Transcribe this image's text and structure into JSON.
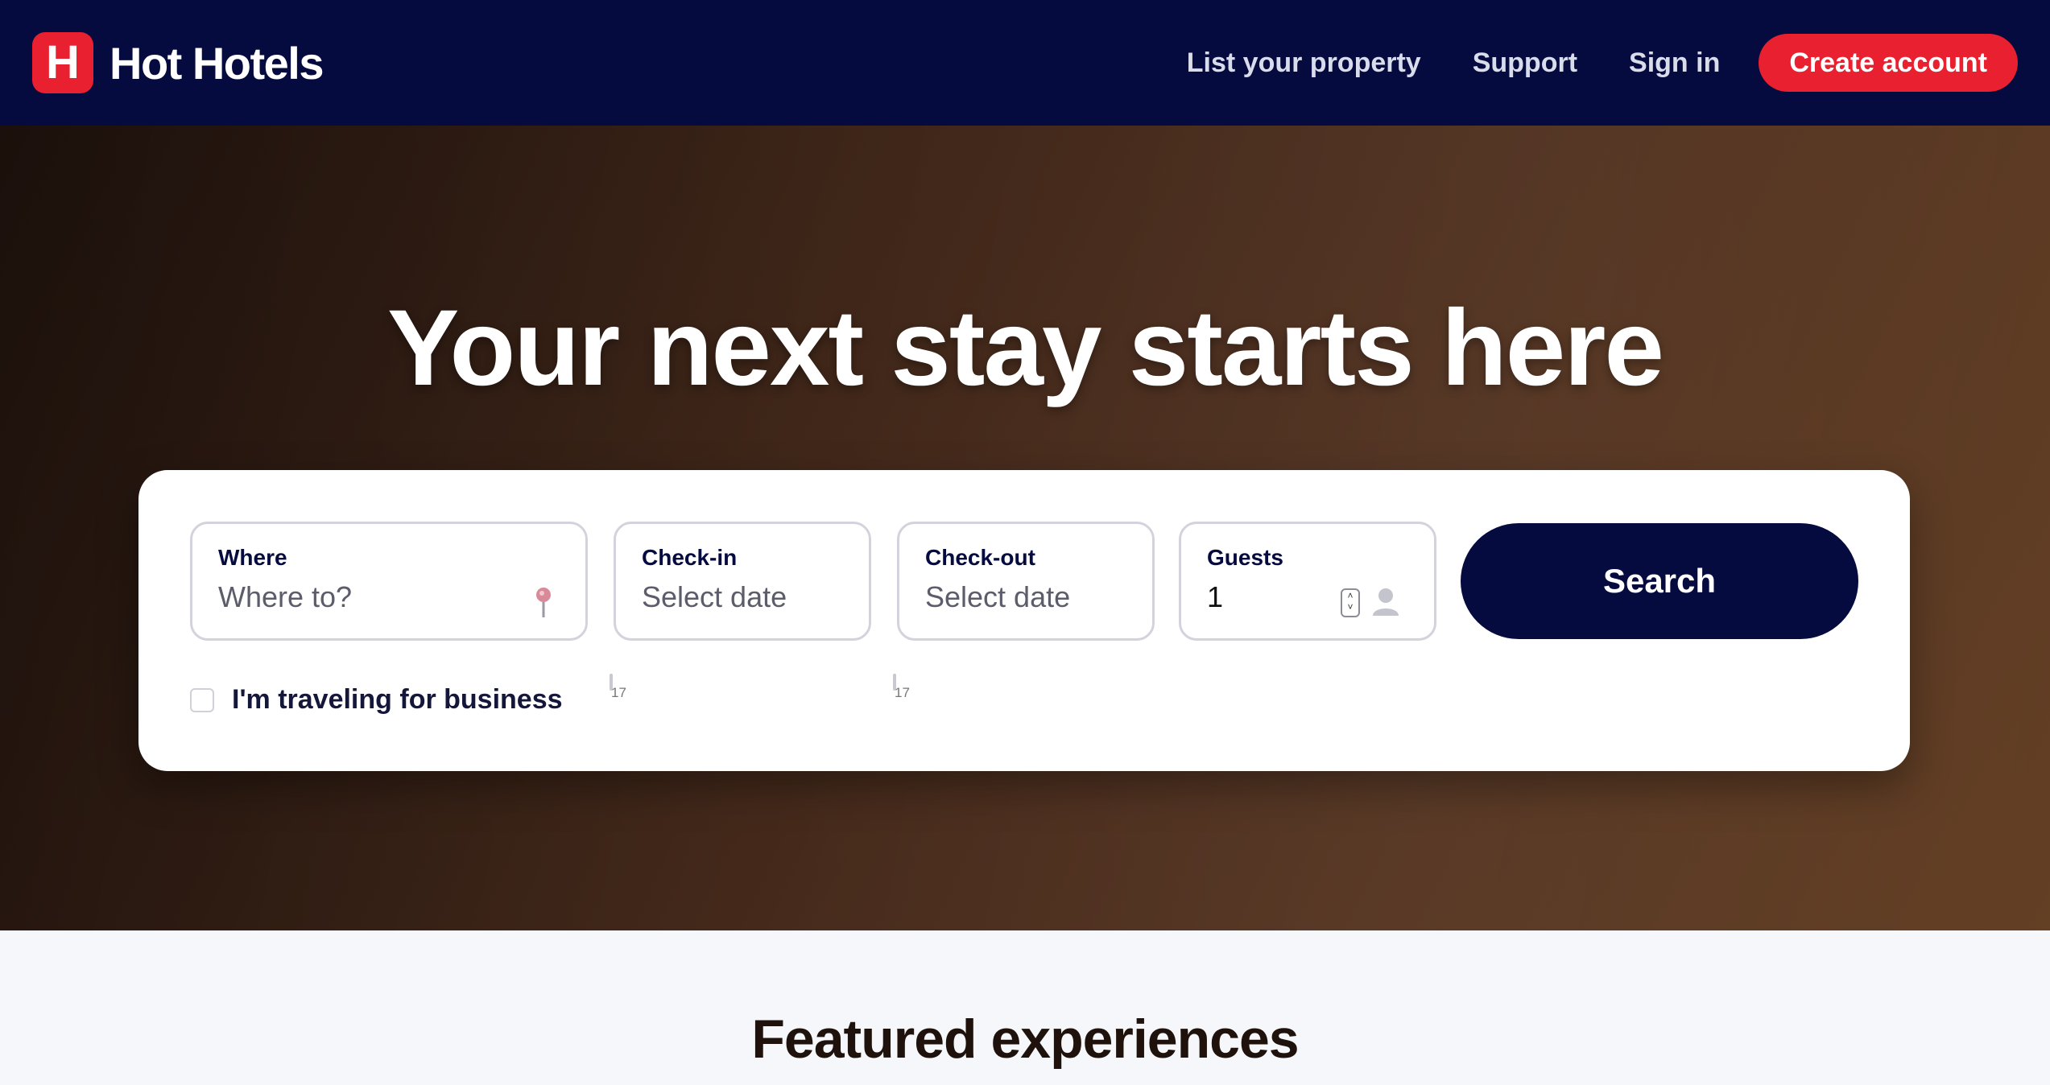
{
  "nav": {
    "brand_letter": "H",
    "brand_name": "Hot Hotels",
    "links": [
      "List your property",
      "Support",
      "Sign in"
    ],
    "cta": "Create account"
  },
  "hero": {
    "title": "Your next stay starts here"
  },
  "search": {
    "where": {
      "label": "Where",
      "placeholder": "Where to?",
      "icon": "map-pin-icon"
    },
    "checkin": {
      "label": "Check-in",
      "placeholder": "Select date",
      "icon": "calendar-icon",
      "icon_text": "17"
    },
    "checkout": {
      "label": "Check-out",
      "placeholder": "Select date",
      "icon": "calendar-icon",
      "icon_text": "17"
    },
    "guests": {
      "label": "Guests",
      "value": "1",
      "icon": "person-icon"
    },
    "button": "Search",
    "business_label": "I'm traveling for business",
    "business_checked": false
  },
  "featured": {
    "title": "Featured experiences"
  },
  "colors": {
    "navy": "#050b3f",
    "accent_red": "#e8202f",
    "hero_brown": "#4e2f1e"
  }
}
